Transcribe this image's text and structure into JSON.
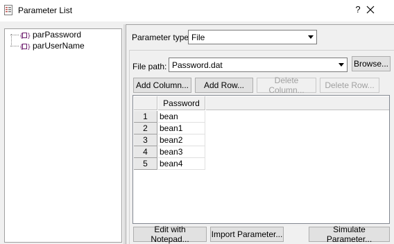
{
  "window": {
    "title": "Parameter List",
    "help_label": "?",
    "close_icon": "close-icon"
  },
  "tree": {
    "items": [
      {
        "label": "parPassword",
        "icon": "parameter-icon"
      },
      {
        "label": "parUserName",
        "icon": "parameter-icon"
      }
    ]
  },
  "parameter_type": {
    "label": "Parameter type:",
    "value": "File"
  },
  "file_path": {
    "label": "File path:",
    "value": "Password.dat",
    "browse_label": "Browse..."
  },
  "grid_toolbar": {
    "add_column": "Add Column...",
    "add_row": "Add Row...",
    "delete_column": "Delete Column...",
    "delete_row": "Delete Row..."
  },
  "grid": {
    "columns": [
      "Password"
    ],
    "rows": [
      {
        "num": "1",
        "value": "bean"
      },
      {
        "num": "2",
        "value": "bean1"
      },
      {
        "num": "3",
        "value": "bean2"
      },
      {
        "num": "4",
        "value": "bean3"
      },
      {
        "num": "5",
        "value": "bean4"
      }
    ]
  },
  "footer": {
    "edit_notepad": "Edit with Notepad...",
    "import_parameter": "Import Parameter...",
    "simulate_parameter": "Simulate Parameter..."
  },
  "colors": {
    "window_bg": "#f0f0f0",
    "button_bg": "#e1e1e1",
    "param_icon": "#6b1a6b"
  }
}
